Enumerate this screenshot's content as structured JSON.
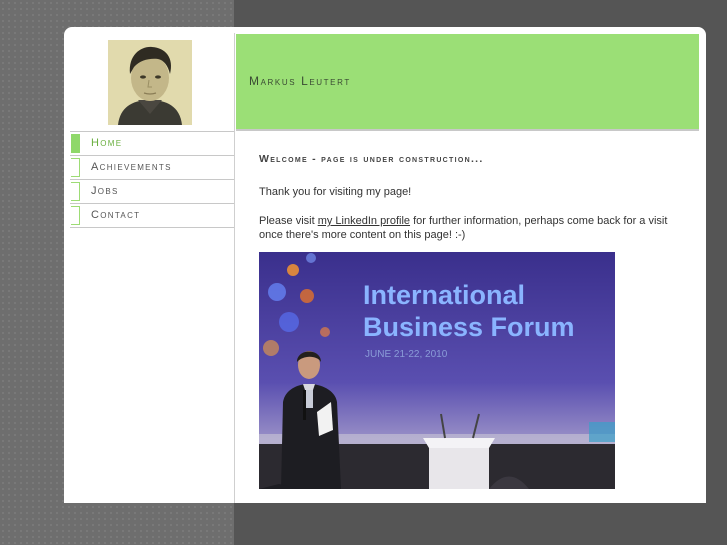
{
  "site": {
    "title": "Markus Leutert"
  },
  "nav": {
    "items": [
      {
        "label": "Home",
        "active": true
      },
      {
        "label": "Achievements",
        "active": false
      },
      {
        "label": "Jobs",
        "active": false
      },
      {
        "label": "Contact",
        "active": false
      }
    ]
  },
  "content": {
    "heading": "Welcome - page is under construction...",
    "paragraph1": "Thank you for visiting my page!",
    "paragraph2_before": "Please visit ",
    "paragraph2_link": "my LinkedIn profile",
    "paragraph2_after": " for further information, perhaps come back for a visit once there's more content on this page! :-)"
  },
  "photo": {
    "title_line1": "International",
    "title_line2": "Business Forum",
    "date": "JUNE 21-22, 2010"
  },
  "colors": {
    "accent_green": "#9bdf76",
    "nav_active": "#8fd86a"
  }
}
